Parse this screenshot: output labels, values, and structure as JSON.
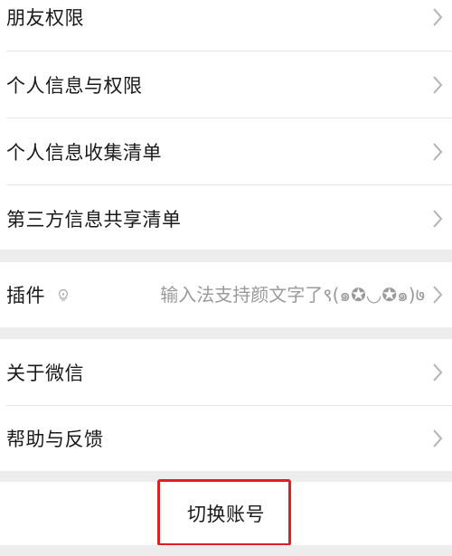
{
  "group1": {
    "items": [
      {
        "label": "朋友权限"
      },
      {
        "label": "个人信息与权限"
      },
      {
        "label": "个人信息收集清单"
      },
      {
        "label": "第三方信息共享清单"
      }
    ]
  },
  "plugin": {
    "label": "插件",
    "value": "输入法支持颜文字了९(๑✪◡✪๑)७",
    "icon": "lightbulb-icon"
  },
  "group3": {
    "items": [
      {
        "label": "关于微信"
      },
      {
        "label": "帮助与反馈"
      }
    ]
  },
  "switch_account": {
    "label": "切换账号"
  },
  "colors": {
    "background": "#ededed",
    "row": "#ffffff",
    "text": "#1a1a1a",
    "secondary_text": "#9a9a9a",
    "highlight": "#e02020"
  }
}
